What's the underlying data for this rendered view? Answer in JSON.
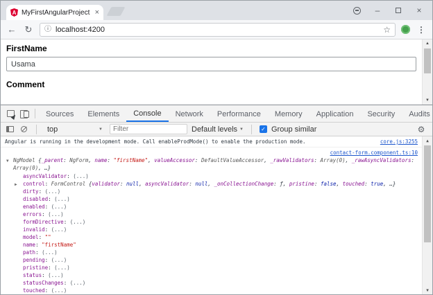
{
  "colors": {
    "accent": "#1a73e8",
    "angular_red": "#dd0031",
    "source_link": "#1a55cc",
    "property_key": "#881391",
    "string_value": "#c41a16",
    "keyword_value": "#0d22aa"
  },
  "icons": {
    "close": "×",
    "minimize": "–",
    "back": "←",
    "refresh": "↻",
    "info": "ⓘ",
    "star": "☆",
    "menu": "⋮",
    "settings": "⚙",
    "dropdown": "▼",
    "check": "✓",
    "arrow_expanded": "▼",
    "arrow_collapsed": "▶",
    "scroll_up": "▲",
    "scroll_down": "▼"
  },
  "browser": {
    "tab_title": "MyFirstAngularProject",
    "tab_icon_letter": "A",
    "url": "localhost:4200"
  },
  "page": {
    "firstname_label": "FirstName",
    "firstname_value": "Usama",
    "comment_label": "Comment"
  },
  "devtools": {
    "tabs": [
      {
        "label": "Sources"
      },
      {
        "label": "Elements"
      },
      {
        "label": "Console"
      },
      {
        "label": "Network"
      },
      {
        "label": "Performance"
      },
      {
        "label": "Memory"
      },
      {
        "label": "Application"
      },
      {
        "label": "Security"
      },
      {
        "label": "Audits"
      }
    ],
    "active_tab": "Console",
    "toolbar": {
      "context": "top",
      "filter_placeholder": "Filter",
      "levels_label": "Default levels",
      "group_similar_label": "Group similar",
      "group_similar_checked": true
    },
    "console": {
      "messages": [
        {
          "text": "Angular is running in the development mode. Call enableProdMode() to enable the production mode.",
          "source": "core.js:3255"
        },
        {
          "source": "contact-form.component.ts:10"
        }
      ],
      "preview_tokens": [
        {
          "t": "NgModel",
          "c": "obj"
        },
        {
          "t": " {",
          "c": "plain"
        },
        {
          "t": "_parent",
          "c": "key"
        },
        {
          "t": ": ",
          "c": "plain"
        },
        {
          "t": "NgForm",
          "c": "obj"
        },
        {
          "t": ", ",
          "c": "plain"
        },
        {
          "t": "name",
          "c": "key"
        },
        {
          "t": ": ",
          "c": "plain"
        },
        {
          "t": "\"firstName\"",
          "c": "string"
        },
        {
          "t": ", ",
          "c": "plain"
        },
        {
          "t": "valueAccessor",
          "c": "key"
        },
        {
          "t": ": ",
          "c": "plain"
        },
        {
          "t": "DefaultValueAccessor",
          "c": "obj"
        },
        {
          "t": ", ",
          "c": "plain"
        },
        {
          "t": "_rawValidators",
          "c": "key"
        },
        {
          "t": ": ",
          "c": "plain"
        },
        {
          "t": "Array(0)",
          "c": "obj"
        },
        {
          "t": ", ",
          "c": "plain"
        },
        {
          "t": "_rawAsyncValidators",
          "c": "key"
        },
        {
          "t": ": ",
          "c": "plain"
        },
        {
          "t": "Array(0)",
          "c": "obj"
        },
        {
          "t": ", ",
          "c": "plain"
        },
        {
          "t": "…}",
          "c": "plain"
        }
      ],
      "properties": [
        {
          "key": "asyncValidator",
          "value": "(...)"
        },
        {
          "key": "control",
          "tokens": [
            {
              "t": "FormControl",
              "c": "obj"
            },
            {
              "t": " {",
              "c": "plain"
            },
            {
              "t": "validator",
              "c": "key"
            },
            {
              "t": ": ",
              "c": "plain"
            },
            {
              "t": "null",
              "c": "keyword"
            },
            {
              "t": ", ",
              "c": "plain"
            },
            {
              "t": "asyncValidator",
              "c": "key"
            },
            {
              "t": ": ",
              "c": "plain"
            },
            {
              "t": "null",
              "c": "keyword"
            },
            {
              "t": ", ",
              "c": "plain"
            },
            {
              "t": "_onCollectionChange",
              "c": "key"
            },
            {
              "t": ": ",
              "c": "plain"
            },
            {
              "t": "ƒ",
              "c": "func"
            },
            {
              "t": ", ",
              "c": "plain"
            },
            {
              "t": "pristine",
              "c": "key"
            },
            {
              "t": ": ",
              "c": "plain"
            },
            {
              "t": "false",
              "c": "keyword"
            },
            {
              "t": ", ",
              "c": "plain"
            },
            {
              "t": "touched",
              "c": "key"
            },
            {
              "t": ": ",
              "c": "plain"
            },
            {
              "t": "true",
              "c": "keyword"
            },
            {
              "t": ", ",
              "c": "plain"
            },
            {
              "t": "…}",
              "c": "plain"
            }
          ]
        },
        {
          "key": "dirty",
          "value": "(...)"
        },
        {
          "key": "disabled",
          "value": "(...)"
        },
        {
          "key": "enabled",
          "value": "(...)"
        },
        {
          "key": "errors",
          "value": "(...)"
        },
        {
          "key": "formDirective",
          "value": "(...)"
        },
        {
          "key": "invalid",
          "value": "(...)"
        },
        {
          "key": "model",
          "value": "\"\""
        },
        {
          "key": "name",
          "value": "\"firstName\""
        },
        {
          "key": "path",
          "value": "(...)"
        },
        {
          "key": "pending",
          "value": "(...)"
        },
        {
          "key": "pristine",
          "value": "(...)"
        },
        {
          "key": "status",
          "value": "(...)"
        },
        {
          "key": "statusChanges",
          "value": "(...)"
        },
        {
          "key": "touched",
          "value": "(...)"
        }
      ]
    }
  }
}
